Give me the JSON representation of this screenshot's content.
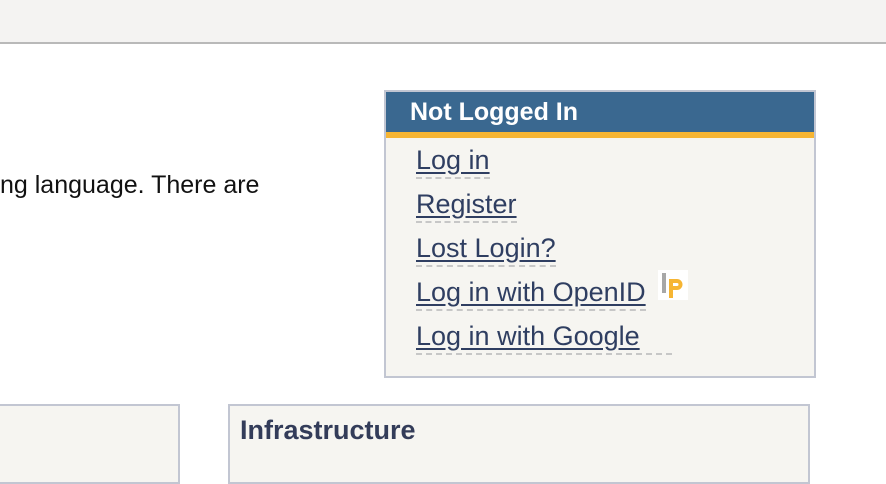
{
  "intro": {
    "text": "ng language. There are"
  },
  "login_box": {
    "title": "Not Logged In",
    "links": [
      {
        "label": "Log in"
      },
      {
        "label": "Register"
      },
      {
        "label": "Lost Login?"
      },
      {
        "label": "Log in with OpenID",
        "icon": "openid-icon"
      },
      {
        "label": "Log in with Google"
      }
    ]
  },
  "panels": {
    "infrastructure_title": "Infrastructure"
  },
  "colors": {
    "header_bg": "#3a6890",
    "header_accent": "#f6b533",
    "link": "#2f3e61",
    "box_bg": "#f6f5f1"
  }
}
